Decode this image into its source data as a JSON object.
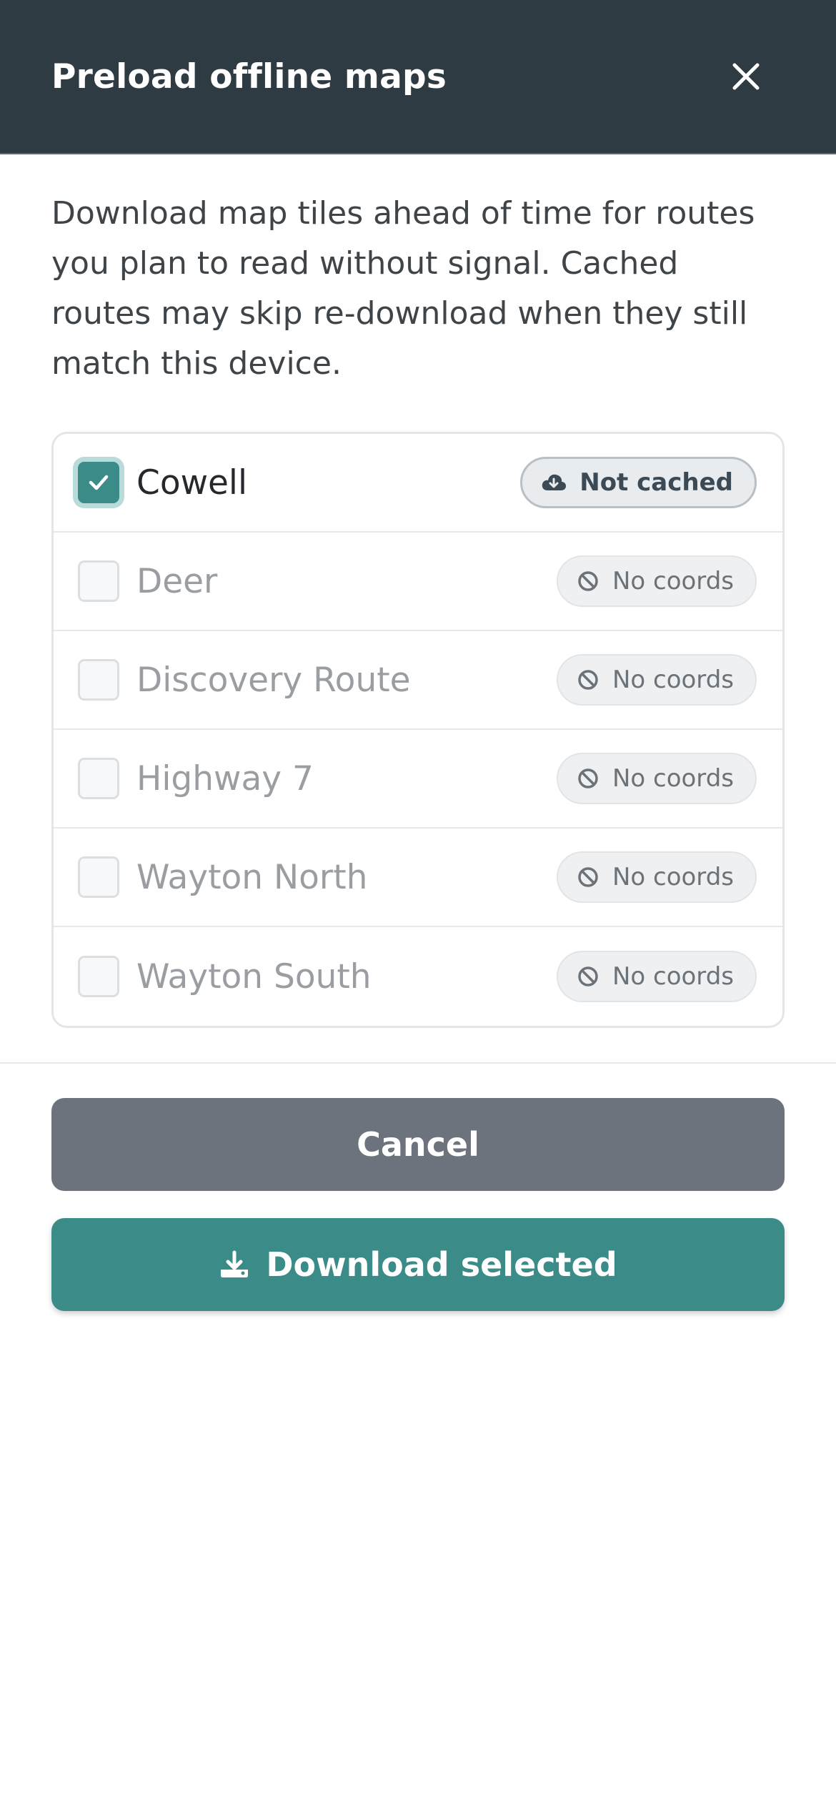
{
  "header": {
    "title": "Preload offline maps",
    "close_icon": "close-icon"
  },
  "description": "Download map tiles ahead of time for routes you plan to read without signal. Cached routes may skip re-download when they still match this device.",
  "routes": [
    {
      "name": "Cowell",
      "checked": true,
      "enabled": true,
      "badge": "Not cached",
      "badge_icon": "cloud-download-icon"
    },
    {
      "name": "Deer",
      "checked": false,
      "enabled": false,
      "badge": "No coords",
      "badge_icon": "ban-icon"
    },
    {
      "name": "Discovery Route",
      "checked": false,
      "enabled": false,
      "badge": "No coords",
      "badge_icon": "ban-icon"
    },
    {
      "name": "Highway 7",
      "checked": false,
      "enabled": false,
      "badge": "No coords",
      "badge_icon": "ban-icon"
    },
    {
      "name": "Wayton North",
      "checked": false,
      "enabled": false,
      "badge": "No coords",
      "badge_icon": "ban-icon"
    },
    {
      "name": "Wayton South",
      "checked": false,
      "enabled": false,
      "badge": "No coords",
      "badge_icon": "ban-icon"
    }
  ],
  "actions": {
    "cancel_label": "Cancel",
    "download_label": "Download selected",
    "download_icon": "download-icon"
  },
  "colors": {
    "header_bg": "#2e3b43",
    "accent": "#3b8b89",
    "cancel_bg": "#6c737c"
  }
}
